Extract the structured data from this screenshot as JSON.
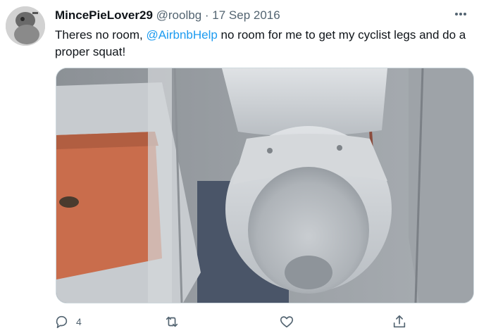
{
  "tweet": {
    "display_name": "MincePieLover29",
    "handle": "@roolbg",
    "separator": "·",
    "date": "17 Sep 2016",
    "text_before": "Theres no room, ",
    "mention": "@AirbnbHelp",
    "text_after": " no room for me to get my cyclist legs and do a proper squat!",
    "reply_count": "4"
  },
  "icons": {
    "more": "more-horizontal-icon",
    "reply": "reply-icon",
    "retweet": "retweet-icon",
    "like": "heart-icon",
    "share": "share-icon"
  },
  "colors": {
    "text": "#0f1419",
    "secondary": "#536471",
    "link": "#1d9bf0"
  }
}
